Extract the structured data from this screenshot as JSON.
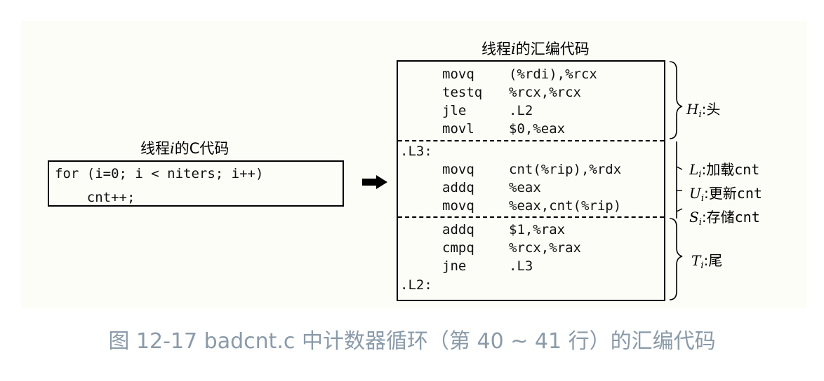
{
  "c_code": {
    "title_prefix": "线程",
    "title_var": "i",
    "title_suffix": "的C代码",
    "lines": [
      "for (i=0; i < niters; i++)",
      "    cnt++;"
    ]
  },
  "asm_code": {
    "title_prefix": "线程",
    "title_var": "i",
    "title_suffix": "的汇编代码",
    "head": [
      {
        "op": "movq",
        "args": "(%rdi),%rcx"
      },
      {
        "op": "testq",
        "args": "%rcx,%rcx"
      },
      {
        "op": "jle",
        "args": ".L2"
      },
      {
        "op": "movl",
        "args": "$0,%eax"
      }
    ],
    "label_l3": ".L3:",
    "body": [
      {
        "op": "movq",
        "args": "cnt(%rip),%rdx"
      },
      {
        "op": "addq",
        "args": "%eax"
      },
      {
        "op": "movq",
        "args": "%eax,cnt(%rip)"
      }
    ],
    "tail": [
      {
        "op": "addq",
        "args": "$1,%rax"
      },
      {
        "op": "cmpq",
        "args": "%rcx,%rax"
      },
      {
        "op": "jne",
        "args": ".L3"
      }
    ],
    "label_l2": ".L2:"
  },
  "annotations": {
    "head": {
      "sym": "H",
      "sub": "i",
      "sep": ":",
      "text": "头"
    },
    "load": {
      "sym": "L",
      "sub": "i",
      "sep": ":",
      "text": "加载",
      "mono": "cnt"
    },
    "update": {
      "sym": "U",
      "sub": "i",
      "sep": ":",
      "text": "更新",
      "mono": "cnt"
    },
    "store": {
      "sym": "S",
      "sub": "i",
      "sep": ":",
      "text": "存储",
      "mono": "cnt"
    },
    "tail": {
      "sym": "T",
      "sub": "i",
      "sep": ":",
      "text": "尾"
    }
  },
  "caption": "图 12-17 badcnt.c 中计数器循环（第 40 ~ 41 行）的汇编代码"
}
